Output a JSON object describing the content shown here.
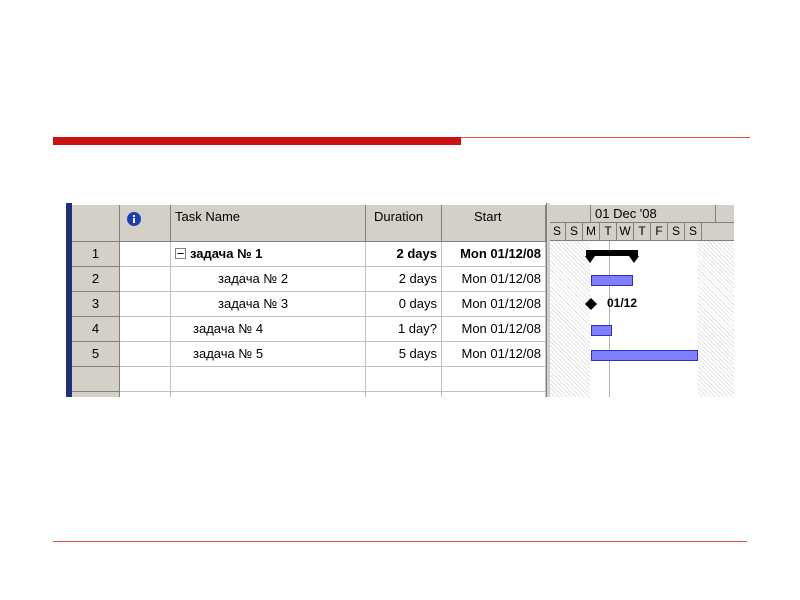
{
  "window": {
    "columns": {
      "id": "",
      "indicator_icon": "info-icon",
      "task_name": "Task Name",
      "duration": "Duration",
      "start": "Start"
    },
    "tasks": [
      {
        "id": "1",
        "name": "задача № 1",
        "duration": "2 days",
        "start": "Mon 01/12/08",
        "summary": true,
        "collapse_icon": "minus-box-icon"
      },
      {
        "id": "2",
        "name": "задача № 2",
        "duration": "2 days",
        "start": "Mon 01/12/08"
      },
      {
        "id": "3",
        "name": "задача № 3",
        "duration": "0 days",
        "start": "Mon 01/12/08",
        "milestone": true
      },
      {
        "id": "4",
        "name": "задача № 4",
        "duration": "1 day?",
        "start": "Mon 01/12/08"
      },
      {
        "id": "5",
        "name": "задача № 5",
        "duration": "5 days",
        "start": "Mon 01/12/08"
      }
    ],
    "gantt": {
      "week_label": "01 Dec '08",
      "days": [
        "S",
        "S",
        "M",
        "T",
        "W",
        "T",
        "F",
        "S",
        "S"
      ],
      "milestone_label": "01/12",
      "bar_color": "#8080ff",
      "summary_color": "#000000"
    }
  },
  "colors": {
    "accent_red": "#cc1111",
    "grid_header": "#d4d0c8",
    "left_strip": "#1f2f7a"
  }
}
